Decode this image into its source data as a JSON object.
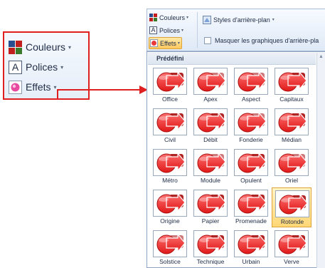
{
  "callout": {
    "couleurs": "Couleurs",
    "polices": "Polices",
    "effets": "Effets",
    "caret": "▾",
    "polices_icon_glyph": "A"
  },
  "ribbon": {
    "couleurs": "Couleurs",
    "polices": "Polices",
    "effets": "Effets",
    "styles": "Styles d'arrière-plan",
    "masquer": "Masquer les graphiques d'arrière-pla",
    "caret": "▾",
    "polices_icon_glyph": "A"
  },
  "gallery": {
    "header": "Prédéfini",
    "selected": "Rotonde",
    "items": [
      {
        "label": "Office"
      },
      {
        "label": "Apex"
      },
      {
        "label": "Aspect"
      },
      {
        "label": "Capitaux"
      },
      {
        "label": "Civil"
      },
      {
        "label": "Débit"
      },
      {
        "label": "Fonderie"
      },
      {
        "label": "Médian"
      },
      {
        "label": "Métro"
      },
      {
        "label": "Module"
      },
      {
        "label": "Opulent"
      },
      {
        "label": "Oriel"
      },
      {
        "label": "Origine"
      },
      {
        "label": "Papier"
      },
      {
        "label": "Promenade"
      },
      {
        "label": "Rotonde"
      },
      {
        "label": "Solstice"
      },
      {
        "label": "Technique"
      },
      {
        "label": "Urbain"
      },
      {
        "label": "Verve"
      }
    ]
  },
  "colors": {
    "highlight_border": "#e02020",
    "effect_red": "#e01818",
    "effect_dark_red": "#a80c0c",
    "selected_fill": "#ffd776"
  }
}
